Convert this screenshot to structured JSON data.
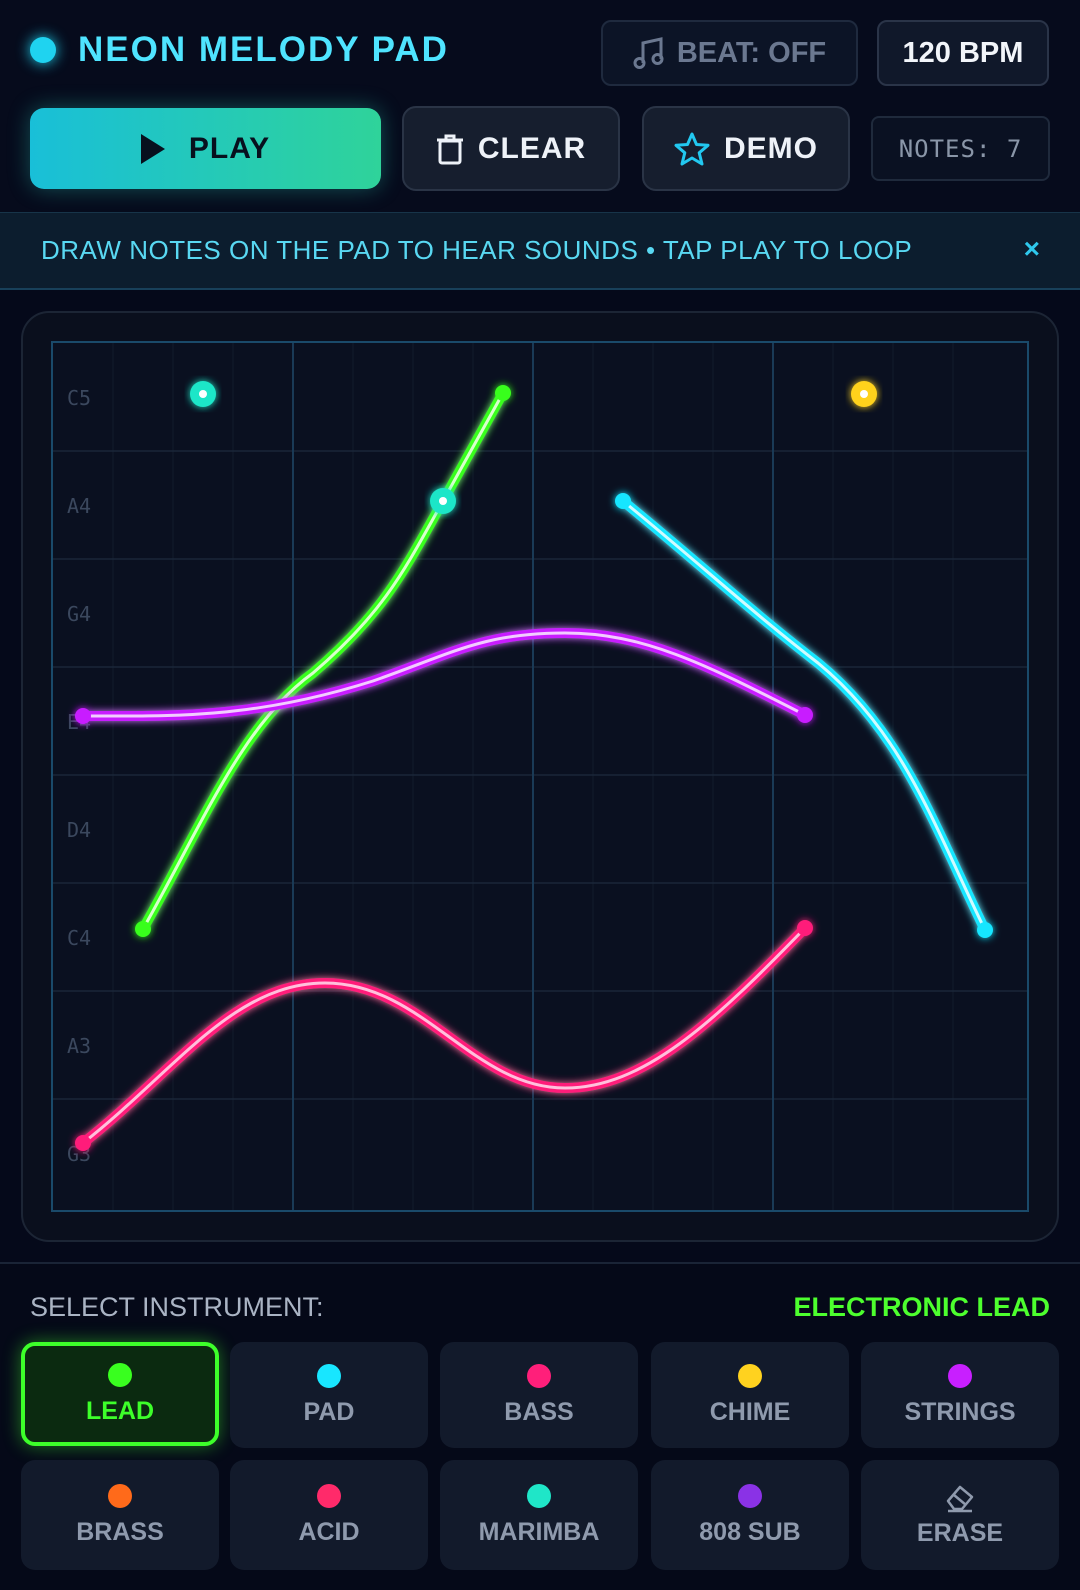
{
  "header": {
    "title": "NEON MELODY PAD",
    "beat_label": "BEAT: OFF",
    "bpm": "120 BPM",
    "play_label": "PLAY",
    "clear_label": "CLEAR",
    "demo_label": "DEMO",
    "notes_label": "NOTES: 7"
  },
  "banner": {
    "text": "DRAW NOTES ON THE PAD TO HEAR SOUNDS • TAP PLAY TO LOOP",
    "close": "×"
  },
  "pad": {
    "note_labels": [
      "C5",
      "A4",
      "G4",
      "E4",
      "D4",
      "C4",
      "A3",
      "G3"
    ]
  },
  "instruments": {
    "select_label": "SELECT INSTRUMENT:",
    "current": "ELECTRONIC LEAD",
    "items": [
      {
        "label": "LEAD",
        "color": "#39ff1f",
        "active": true
      },
      {
        "label": "PAD",
        "color": "#18e6ff"
      },
      {
        "label": "BASS",
        "color": "#ff1f7a"
      },
      {
        "label": "CHIME",
        "color": "#ffd21f"
      },
      {
        "label": "STRINGS",
        "color": "#c81fff"
      },
      {
        "label": "BRASS",
        "color": "#ff6a1a"
      },
      {
        "label": "ACID",
        "color": "#ff2a6a"
      },
      {
        "label": "MARIMBA",
        "color": "#1fe6c8"
      },
      {
        "label": "808 SUB",
        "color": "#8a32e6"
      },
      {
        "label": "ERASE",
        "icon": "eraser-icon"
      }
    ]
  },
  "colors": {
    "accent": "#4fe4ff",
    "lead": "#39ff1f",
    "pad": "#18e6ff",
    "bass": "#ff1f7a",
    "chime": "#ffd21f",
    "strings": "#c81fff"
  }
}
